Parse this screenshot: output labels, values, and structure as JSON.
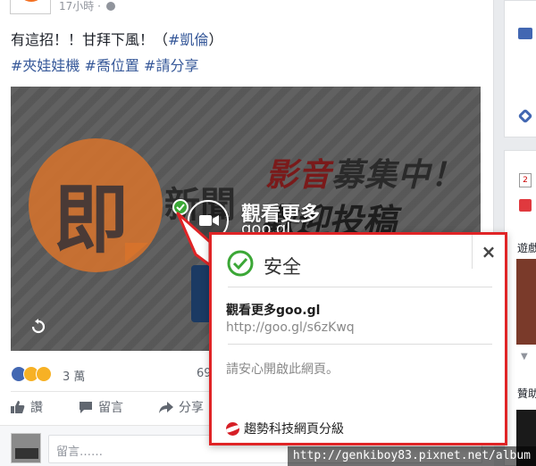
{
  "post": {
    "time": "17小時 ·",
    "text_line1": "有這招！！甘拜下風！（",
    "text_line1_tag": "#凱倫",
    "text_line1_end": "）",
    "hashtags": [
      "#夾娃娃機",
      "#喬位置",
      "#請分享"
    ]
  },
  "video": {
    "bubble_char": "即",
    "news_fragment": "新聞",
    "banner_title_red": "影音",
    "banner_title_dark": "募集中！",
    "banner_sub": "歡迎投稿",
    "overlay_label": "觀看更多",
    "overlay_url": "goo.gl"
  },
  "footer": {
    "reaction_count": "3 萬",
    "comment_count": "69",
    "actions": {
      "like": "讚",
      "comment": "留言",
      "share": "分享"
    },
    "comment_placeholder": "留言……"
  },
  "rail": {
    "calendar_day": "2",
    "label_games": "遊戲",
    "label_sponsored": "贊助"
  },
  "popup": {
    "title": "安全",
    "close": "×",
    "link_title": "觀看更多goo.gl",
    "url": "http://goo.gl/s6zKwq",
    "message": "請安心開啟此網頁。",
    "footer": "趨勢科技網頁分級"
  },
  "watermark": "http://genkiboy83.pixnet.net/album",
  "colors": {
    "facebook_blue": "#4267b2",
    "hashtag": "#365899",
    "safe_green": "#3ba736",
    "popup_border": "#e02426"
  }
}
